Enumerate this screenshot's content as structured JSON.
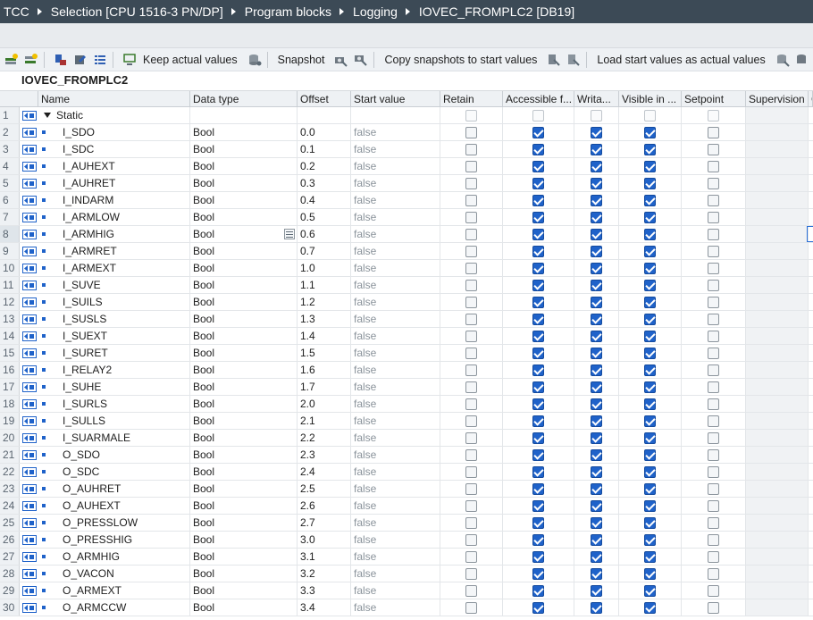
{
  "breadcrumb": [
    "TCC",
    "Selection [CPU 1516-3 PN/DP]",
    "Program blocks",
    "Logging",
    "IOVEC_FROMPLC2 [DB19]"
  ],
  "toolbar": {
    "keep_actual": "Keep actual values",
    "snapshot": "Snapshot",
    "copy_snapshots": "Copy snapshots to start values",
    "load_start": "Load start values as actual values"
  },
  "block_title": "IOVEC_FROMPLC2",
  "columns": [
    "Name",
    "Data type",
    "Offset",
    "Start value",
    "Retain",
    "Accessible f...",
    "Writa...",
    "Visible in ...",
    "Setpoint",
    "Supervision",
    "C"
  ],
  "static_row": {
    "num": "1",
    "name": "Static"
  },
  "rows": [
    {
      "num": "2",
      "name": "I_SDO",
      "type": "Bool",
      "offset": "0.0",
      "start": "false"
    },
    {
      "num": "3",
      "name": "I_SDC",
      "type": "Bool",
      "offset": "0.1",
      "start": "false"
    },
    {
      "num": "4",
      "name": "I_AUHEXT",
      "type": "Bool",
      "offset": "0.2",
      "start": "false"
    },
    {
      "num": "5",
      "name": "I_AUHRET",
      "type": "Bool",
      "offset": "0.3",
      "start": "false"
    },
    {
      "num": "6",
      "name": "I_INDARM",
      "type": "Bool",
      "offset": "0.4",
      "start": "false"
    },
    {
      "num": "7",
      "name": "I_ARMLOW",
      "type": "Bool",
      "offset": "0.5",
      "start": "false"
    },
    {
      "num": "8",
      "name": "I_ARMHIG",
      "type": "Bool",
      "offset": "0.6",
      "start": "false"
    },
    {
      "num": "9",
      "name": "I_ARMRET",
      "type": "Bool",
      "offset": "0.7",
      "start": "false"
    },
    {
      "num": "10",
      "name": "I_ARMEXT",
      "type": "Bool",
      "offset": "1.0",
      "start": "false"
    },
    {
      "num": "11",
      "name": "I_SUVE",
      "type": "Bool",
      "offset": "1.1",
      "start": "false"
    },
    {
      "num": "12",
      "name": "I_SUILS",
      "type": "Bool",
      "offset": "1.2",
      "start": "false"
    },
    {
      "num": "13",
      "name": "I_SUSLS",
      "type": "Bool",
      "offset": "1.3",
      "start": "false"
    },
    {
      "num": "14",
      "name": "I_SUEXT",
      "type": "Bool",
      "offset": "1.4",
      "start": "false"
    },
    {
      "num": "15",
      "name": "I_SURET",
      "type": "Bool",
      "offset": "1.5",
      "start": "false"
    },
    {
      "num": "16",
      "name": "I_RELAY2",
      "type": "Bool",
      "offset": "1.6",
      "start": "false"
    },
    {
      "num": "17",
      "name": "I_SUHE",
      "type": "Bool",
      "offset": "1.7",
      "start": "false"
    },
    {
      "num": "18",
      "name": "I_SURLS",
      "type": "Bool",
      "offset": "2.0",
      "start": "false"
    },
    {
      "num": "19",
      "name": "I_SULLS",
      "type": "Bool",
      "offset": "2.1",
      "start": "false"
    },
    {
      "num": "20",
      "name": "I_SUARMALE",
      "type": "Bool",
      "offset": "2.2",
      "start": "false"
    },
    {
      "num": "21",
      "name": "O_SDO",
      "type": "Bool",
      "offset": "2.3",
      "start": "false"
    },
    {
      "num": "22",
      "name": "O_SDC",
      "type": "Bool",
      "offset": "2.4",
      "start": "false"
    },
    {
      "num": "23",
      "name": "O_AUHRET",
      "type": "Bool",
      "offset": "2.5",
      "start": "false"
    },
    {
      "num": "24",
      "name": "O_AUHEXT",
      "type": "Bool",
      "offset": "2.6",
      "start": "false"
    },
    {
      "num": "25",
      "name": "O_PRESSLOW",
      "type": "Bool",
      "offset": "2.7",
      "start": "false"
    },
    {
      "num": "26",
      "name": "O_PRESSHIG",
      "type": "Bool",
      "offset": "3.0",
      "start": "false"
    },
    {
      "num": "27",
      "name": "O_ARMHIG",
      "type": "Bool",
      "offset": "3.1",
      "start": "false"
    },
    {
      "num": "28",
      "name": "O_VACON",
      "type": "Bool",
      "offset": "3.2",
      "start": "false"
    },
    {
      "num": "29",
      "name": "O_ARMEXT",
      "type": "Bool",
      "offset": "3.3",
      "start": "false"
    },
    {
      "num": "30",
      "name": "O_ARMCCW",
      "type": "Bool",
      "offset": "3.4",
      "start": "false"
    }
  ],
  "checkbox_states": {
    "retain": false,
    "accessible": true,
    "writable": true,
    "visible": true,
    "setpoint": false
  },
  "colors": {
    "titlebar": "#3c4a56",
    "checkbox_on": "#1f62c9",
    "row_number_bg": "#eef1f4"
  }
}
